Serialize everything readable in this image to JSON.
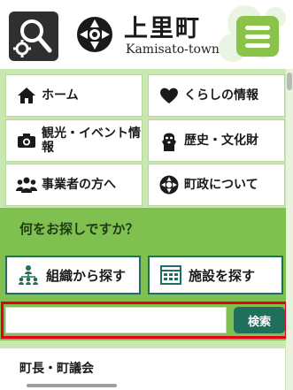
{
  "header": {
    "title": "上里町",
    "subtitle": "Kamisato-town",
    "search_toggle_icon": "search-gear-icon",
    "menu_icon": "hamburger-icon",
    "accent": "#8bc34a"
  },
  "nav": {
    "items": [
      {
        "label": "ホーム",
        "icon": "home-icon"
      },
      {
        "label": "くらしの情報",
        "icon": "heart-icon"
      },
      {
        "label": "観光・イベント情報",
        "icon": "camera-icon"
      },
      {
        "label": "歴史・文化財",
        "icon": "haniwa-icon"
      },
      {
        "label": "事業者の方へ",
        "icon": "people-icon"
      },
      {
        "label": "町政について",
        "icon": "town-emblem-icon"
      }
    ]
  },
  "finder": {
    "heading": "何をお探しですか？",
    "org_label": "組織から探す",
    "facility_label": "施設を探す"
  },
  "search": {
    "value": "",
    "placeholder": "",
    "button_label": "検索"
  },
  "section": {
    "label": "町長・町議会"
  },
  "colors": {
    "green_dark": "#1f6f5c",
    "green_band": "#7fc050",
    "green_light": "#c8e7b1",
    "highlight": "#e3001b"
  }
}
